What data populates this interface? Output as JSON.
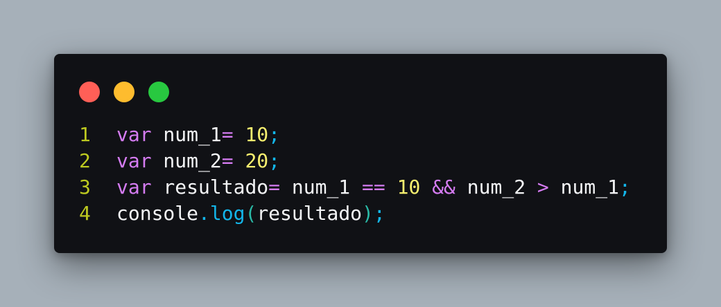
{
  "colors": {
    "page_background": "#a6b0b9",
    "window_background": "#101115",
    "close_dot": "#ff5f57",
    "minimize_dot": "#febc2e",
    "maximize_dot": "#28c840",
    "line_number": "#bdc920",
    "keyword": "#d57cf2",
    "identifier": "#f3f4f6",
    "number": "#f8f06f",
    "operator": "#d57cf2",
    "punctuation": "#13b5e9",
    "paren": "#2ab9a6"
  },
  "window_controls": [
    {
      "name": "close-button",
      "color": "#ff5f57"
    },
    {
      "name": "minimize-button",
      "color": "#febc2e"
    },
    {
      "name": "maximize-button",
      "color": "#28c840"
    }
  ],
  "code": {
    "lines": [
      {
        "number": "1",
        "tokens": [
          {
            "text": "var",
            "kind": "keyword"
          },
          {
            "text": " num_1",
            "kind": "identifier"
          },
          {
            "text": "=",
            "kind": "operator"
          },
          {
            "text": " 10",
            "kind": "number"
          },
          {
            "text": ";",
            "kind": "punctuation"
          }
        ]
      },
      {
        "number": "2",
        "tokens": [
          {
            "text": "var",
            "kind": "keyword"
          },
          {
            "text": " num_2",
            "kind": "identifier"
          },
          {
            "text": "=",
            "kind": "operator"
          },
          {
            "text": " 20",
            "kind": "number"
          },
          {
            "text": ";",
            "kind": "punctuation"
          }
        ]
      },
      {
        "number": "3",
        "tokens": [
          {
            "text": "var",
            "kind": "keyword"
          },
          {
            "text": " resultado",
            "kind": "identifier"
          },
          {
            "text": "=",
            "kind": "operator"
          },
          {
            "text": " num_1 ",
            "kind": "identifier"
          },
          {
            "text": "==",
            "kind": "operator"
          },
          {
            "text": " 10 ",
            "kind": "number"
          },
          {
            "text": "&&",
            "kind": "operator"
          },
          {
            "text": " num_2 ",
            "kind": "identifier"
          },
          {
            "text": ">",
            "kind": "operator"
          },
          {
            "text": " num_1",
            "kind": "identifier"
          },
          {
            "text": ";",
            "kind": "punctuation"
          }
        ]
      },
      {
        "number": "4",
        "tokens": [
          {
            "text": "console",
            "kind": "identifier"
          },
          {
            "text": ".",
            "kind": "punctuation"
          },
          {
            "text": "log",
            "kind": "punctuation"
          },
          {
            "text": "(",
            "kind": "paren"
          },
          {
            "text": "resultado",
            "kind": "identifier"
          },
          {
            "text": ")",
            "kind": "paren"
          },
          {
            "text": ";",
            "kind": "punctuation"
          }
        ]
      }
    ]
  }
}
